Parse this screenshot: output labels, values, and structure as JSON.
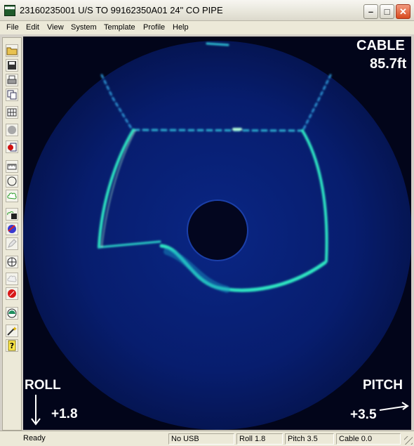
{
  "window": {
    "title": "23160235001 U/S TO 99162350A01 24\" CO PIPE",
    "icon": "pipe-app-icon",
    "controls": {
      "minimize": "–",
      "maximize": "□",
      "close": "✕"
    }
  },
  "menu": {
    "items": [
      "File",
      "Edit",
      "View",
      "System",
      "Template",
      "Profile",
      "Help"
    ]
  },
  "toolbar": {
    "icons": [
      "open-folder-icon",
      "save-icon",
      "print-icon",
      "copy-icon",
      "grid-icon",
      "gray-circle-icon",
      "record-icon",
      "ruler-icon",
      "circle-template-icon",
      "cloud-icon",
      "save-profile-icon",
      "sphere-icon",
      "pencil-icon",
      "compass-icon",
      "cloud-disabled-icon",
      "red-stop-icon",
      "gauge-icon",
      "wand-icon",
      "help-icon"
    ]
  },
  "overlay": {
    "cable_label": "CABLE",
    "cable_value": "85.7ft",
    "roll_label": "ROLL",
    "roll_value": "+1.8",
    "pitch_label": "PITCH",
    "pitch_value": "+3.5"
  },
  "status": {
    "ready": "Ready",
    "usb": "No USB",
    "roll": "Roll 1.8",
    "pitch": "Pitch 3.5",
    "cable": "Cable 0.0"
  },
  "colors": {
    "sonar_background": "#03061f",
    "sonar_disc": "#061c6b",
    "sonar_return": "#2fe6c2",
    "sonar_highlight": "#b8ffd8"
  }
}
